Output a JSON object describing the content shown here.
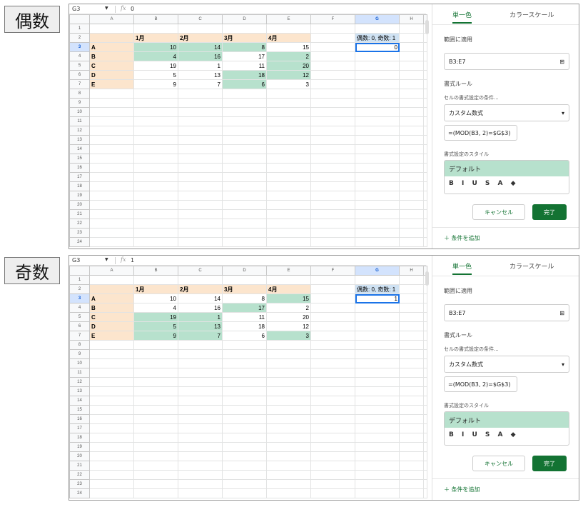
{
  "columns": [
    "A",
    "B",
    "C",
    "D",
    "E",
    "F",
    "G",
    "H"
  ],
  "row_numbers": [
    "1",
    "2",
    "3",
    "4",
    "5",
    "6",
    "7",
    "8",
    "9",
    "10",
    "11",
    "12",
    "13",
    "14",
    "15",
    "16",
    "17",
    "18",
    "19",
    "20",
    "21",
    "22",
    "23",
    "24"
  ],
  "header_row": [
    "",
    "1月",
    "2月",
    "3月",
    "4月"
  ],
  "row_labels": [
    "A",
    "B",
    "C",
    "D",
    "E"
  ],
  "values": [
    [
      10,
      14,
      8,
      15
    ],
    [
      4,
      16,
      17,
      2
    ],
    [
      19,
      1,
      11,
      20
    ],
    [
      5,
      13,
      18,
      12
    ],
    [
      9,
      7,
      6,
      3
    ]
  ],
  "g2_label": "偶数: 0, 奇数: 1",
  "panel": {
    "tab_single": "単一色",
    "tab_scale": "カラースケール",
    "apply_label": "範囲に適用",
    "range": "B3:E7",
    "rules_label": "書式ルール",
    "condition_label": "セルの書式設定の条件...",
    "condition_value": "カスタム数式",
    "formula": "=(MOD(B3, 2)=$G$3)",
    "style_label": "書式設定のスタイル",
    "style_default": "デフォルト",
    "style_tools": "B I U S A ◆",
    "cancel": "キャンセル",
    "done": "完了",
    "add_rule": "＋ 条件を追加"
  },
  "shots": [
    {
      "label": "偶数",
      "cell_ref": "G3",
      "fx_value": "0",
      "g3_value": "0",
      "green_cells": [
        "0-0",
        "0-1",
        "0-2",
        "1-0",
        "1-1",
        "1-3",
        "2-3",
        "3-2",
        "3-3",
        "4-2"
      ]
    },
    {
      "label": "奇数",
      "cell_ref": "G3",
      "fx_value": "1",
      "g3_value": "1",
      "green_cells": [
        "0-3",
        "1-2",
        "2-0",
        "2-1",
        "3-0",
        "3-1",
        "4-0",
        "4-1",
        "4-3"
      ]
    }
  ]
}
